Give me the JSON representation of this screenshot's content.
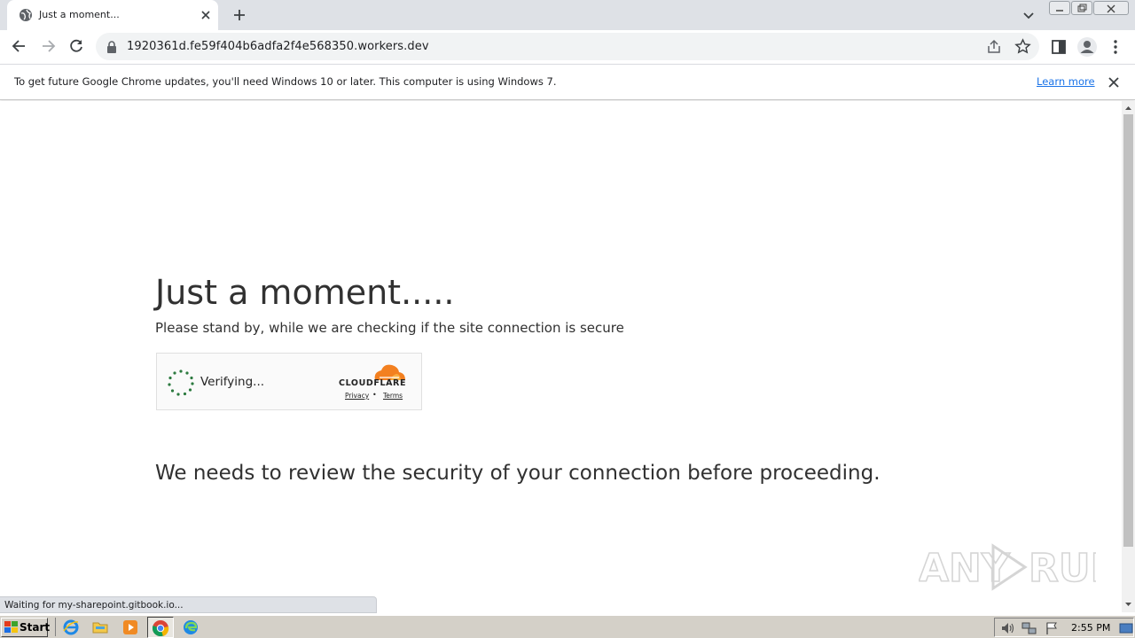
{
  "browser": {
    "tab_title": "Just a moment...",
    "url": "1920361d.fe59f404b6adfa2f4e568350.workers.dev"
  },
  "infobar": {
    "message": "To get future Google Chrome updates, you'll need Windows 10 or later. This computer is using Windows 7.",
    "learn_more": "Learn more"
  },
  "page": {
    "heading": "Just a moment.....",
    "subtext": "Please stand by, while we are checking if the site connection is secure",
    "widget": {
      "status": "Verifying...",
      "brand": "CLOUDFLARE",
      "privacy": "Privacy",
      "separator": "•",
      "terms": "Terms"
    },
    "review_text": "We needs to review the security of your connection before proceeding."
  },
  "status_bar": {
    "text": "Waiting for my-sharepoint.gitbook.io..."
  },
  "watermark": {
    "text": "ANY RUN"
  },
  "taskbar": {
    "start_label": "Start",
    "clock": "2:55 PM"
  },
  "colors": {
    "cloudflare_orange": "#f38020",
    "spinner_green": "#2c7a3f",
    "link_blue": "#1a73e8"
  }
}
